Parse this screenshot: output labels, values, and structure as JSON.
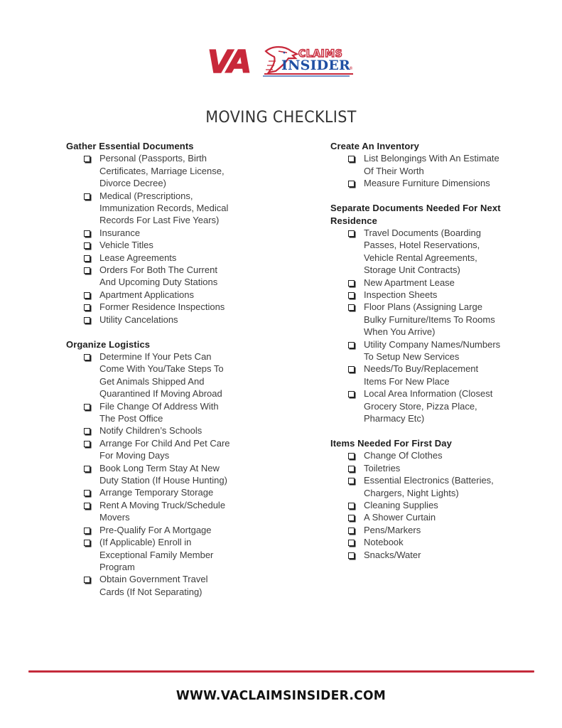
{
  "brand": {
    "logo_va": "VA",
    "logo_claims": "CLAIMS",
    "logo_insider": "INSIDER",
    "registered_mark": "®",
    "red": "#c8283a",
    "blue": "#1f4fa3"
  },
  "title": "MOVING CHECKLIST",
  "left_column": [
    {
      "heading": "Gather Essential Documents",
      "items": [
        "Personal (Passports, Birth Certificates, Marriage License, Divorce Decree)",
        "Medical (Prescriptions, Immunization Records, Medical Records For Last Five Years)",
        "Insurance",
        "Vehicle Titles",
        "Lease Agreements",
        "Orders For Both The Current And Upcoming Duty Stations",
        "Apartment Applications",
        "Former Residence Inspections",
        "Utility Cancelations"
      ]
    },
    {
      "heading": "Organize Logistics",
      "items": [
        "Determine If Your Pets Can Come With You/Take Steps To Get Animals Shipped And Quarantined If Moving Abroad",
        "File Change Of Address With The Post Office",
        "Notify Children’s Schools",
        "Arrange For Child And Pet Care For Moving Days",
        "Book Long Term Stay At New Duty Station (If House Hunting)",
        "Arrange Temporary Storage",
        "Rent A Moving Truck/Schedule Movers",
        "Pre-Qualify For A Mortgage",
        "(If Applicable) Enroll in Exceptional Family Member Program",
        "Obtain Government Travel Cards (If Not Separating)"
      ]
    }
  ],
  "right_column": [
    {
      "heading": "Create An Inventory",
      "items": [
        "List Belongings With An Estimate Of Their Worth",
        "Measure Furniture Dimensions"
      ]
    },
    {
      "heading": "Separate Documents Needed For Next Residence",
      "items": [
        "Travel Documents (Boarding Passes, Hotel Reservations, Vehicle Rental Agreements, Storage Unit Contracts)",
        "New Apartment Lease",
        "Inspection Sheets",
        "Floor Plans (Assigning Large Bulky Furniture/Items To Rooms When You Arrive)",
        "Utility Company Names/Numbers To Setup New Services",
        "Needs/To Buy/Replacement Items For New Place",
        "Local Area Information (Closest Grocery Store, Pizza Place, Pharmacy Etc)"
      ]
    },
    {
      "heading": "Items Needed For First Day",
      "items": [
        "Change Of Clothes",
        "Toiletries",
        "Essential Electronics (Batteries, Chargers, Night Lights)",
        "Cleaning Supplies",
        "A Shower Curtain",
        "Pens/Markers",
        "Notebook",
        "Snacks/Water"
      ]
    }
  ],
  "footer": {
    "url": "WWW.VACLAIMSINSIDER.COM",
    "divider_color": "#c42a3b"
  }
}
